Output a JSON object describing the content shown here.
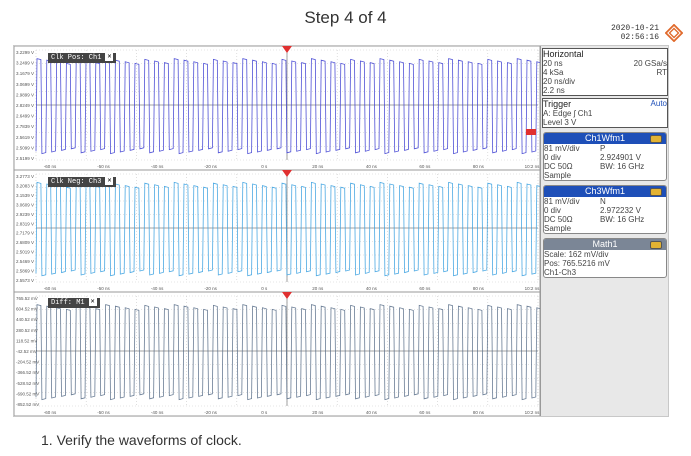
{
  "header": {
    "step_title": "Step 4 of 4"
  },
  "scope": {
    "date": "2020-10-21",
    "time": "02:56:16",
    "logo": "rohde-schwarz-diamond-logo",
    "colors": {
      "ch1": "#3d3fd1",
      "ch3": "#38a0e0",
      "math": "#5a6f8a",
      "trigger": "#e03030",
      "panel_title": "#1e4fb8"
    },
    "diagrams": [
      {
        "label": "Clk Pos: Ch1",
        "y_ticks": [
          "3.2299 V",
          "3.2499 V",
          "3.1679 V",
          "3.0699 V",
          "2.9899 V",
          "2.8249 V",
          "2.6499 V",
          "2.7839 V",
          "2.5619 V",
          "2.5099 V",
          "2.5199 V"
        ],
        "x_ticks": [
          "-60 ns",
          "-50 ns",
          "-40 ns",
          "-20 ns",
          "0 s",
          "20 ns",
          "40 ns",
          "60 ns",
          "80 ns",
          "10:2 ns"
        ]
      },
      {
        "label": "Clk Neg: Ch3",
        "y_ticks": [
          "3.2773 V",
          "3.2083 V",
          "3.1539 V",
          "3.0609 V",
          "2.9239 V",
          "2.8319 V",
          "2.7179 V",
          "2.6809 V",
          "2.5019 V",
          "2.5469 V",
          "2.5869 V",
          "2.5573 V"
        ],
        "x_ticks": [
          "-60 ns",
          "-50 ns",
          "-40 ns",
          "-20 ns",
          "0 s",
          "20 ns",
          "40 ns",
          "60 ns",
          "80 ns",
          "10:2 ns"
        ]
      },
      {
        "label": "Diff: M1",
        "y_ticks": [
          "765.52 mV",
          "604.52 mV",
          "440.52 mV",
          "280.52 mV",
          "118.52 mV",
          "-42.52 mV",
          "-204.52 mV",
          "-366.52 mV",
          "-528.52 mV",
          "-690.52 mV",
          "-852.52 mV"
        ],
        "x_ticks": [
          "-60 ns",
          "-50 ns",
          "-40 ns",
          "-20 ns",
          "0 s",
          "20 ns",
          "40 ns",
          "60 ns",
          "80 ns",
          "10:2 ns"
        ]
      }
    ],
    "horizontal": {
      "title": "Horizontal",
      "line1_left": "20 ns",
      "line1_right": "20 GSa/s",
      "line2_left": "4 kSa",
      "line2_right": "RT",
      "line3": "20 ns/div",
      "line4": "2.2 ns"
    },
    "trigger": {
      "title": "Trigger",
      "mode": "Auto",
      "line1": "A:    Edge  ʃ Ch1",
      "line2": "Level  3 V"
    },
    "ch1": {
      "title": "Ch1Wfm1",
      "scale": "81 mV/div",
      "coupling": "P",
      "offset": "0 div",
      "value": "2.924901 V",
      "impedance": "DC 50Ω",
      "bw": "BW: 16 GHz",
      "mode": "Sample"
    },
    "ch3": {
      "title": "Ch3Wfm1",
      "scale": "81 mV/div",
      "coupling": "N",
      "offset": "0 div",
      "value": "2.972232 V",
      "impedance": "DC 50Ω",
      "bw": "BW: 16 GHz",
      "mode": "Sample"
    },
    "math": {
      "title": "Math1",
      "scale": "Scale: 162 mV/div",
      "pos": "Pos: 765.5216 mV",
      "expr": "Ch1-Ch3"
    }
  },
  "instruction": "1. Verify the waveforms of clock."
}
